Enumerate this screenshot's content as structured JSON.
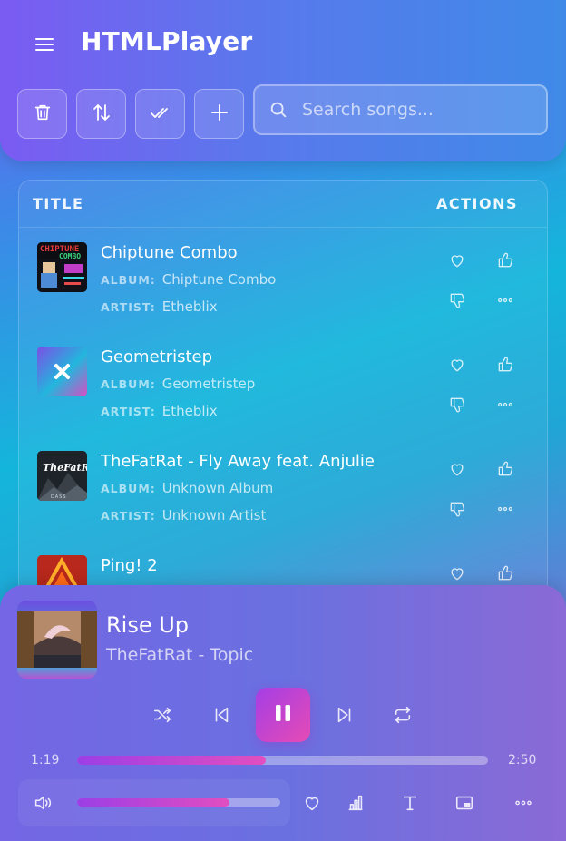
{
  "app": {
    "title": "HTMLPlayer"
  },
  "toolbar": {
    "buttons": [
      {
        "icon": "trash-icon",
        "label": ""
      },
      {
        "icon": "sort-icon",
        "label": ""
      },
      {
        "icon": "check-all-icon",
        "label": ""
      },
      {
        "icon": "plus-icon",
        "label": ""
      }
    ],
    "search_placeholder": "Search songs..."
  },
  "list": {
    "header": {
      "title": "TITLE",
      "actions": "ACTIONS"
    },
    "album_key": "ALBUM:",
    "artist_key": "ARTIST:",
    "songs": [
      {
        "title": "Chiptune Combo",
        "album": "Chiptune Combo",
        "artist": "Etheblix"
      },
      {
        "title": "Geometristep",
        "album": "Geometristep",
        "artist": "Etheblix"
      },
      {
        "title": "TheFatRat - Fly Away feat. Anjulie",
        "album": "Unknown Album",
        "artist": "Unknown Artist"
      },
      {
        "title": "Ping! 2",
        "album": "",
        "artist": ""
      }
    ]
  },
  "player": {
    "title": "Rise Up",
    "artist": "TheFatRat - Topic",
    "current_time": "1:19",
    "duration": "2:50",
    "progress": 0.46,
    "volume": 0.75,
    "state": "playing"
  },
  "colors": {
    "accent_start": "#a43ee6",
    "accent_end": "#e64bb4"
  }
}
